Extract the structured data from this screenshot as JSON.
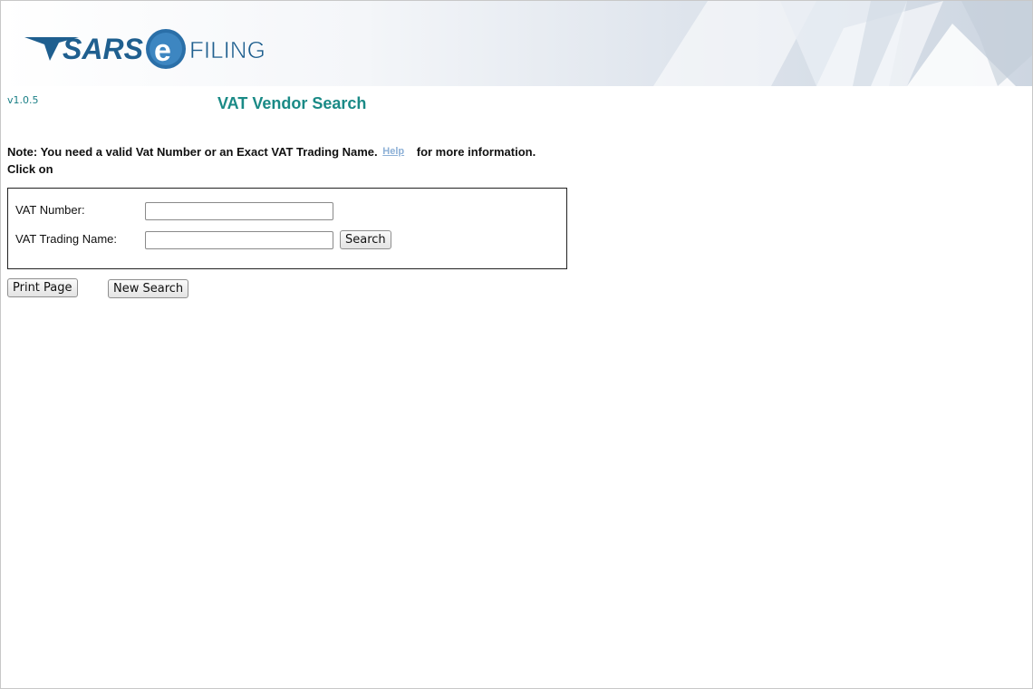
{
  "header": {
    "logo": {
      "sars_text": "SARS",
      "efiling_letter": "e",
      "efiling_text": "FILING"
    }
  },
  "version": "v1.0.5",
  "page_title": "VAT Vendor Search",
  "note": {
    "text": "Note: You need a valid Vat Number or an Exact VAT Trading Name.",
    "help_link": "Help",
    "suffix": "for more information.",
    "click_on": "Click on"
  },
  "form": {
    "vat_number_label": "VAT Number:",
    "vat_number_value": "",
    "trading_name_label": "VAT Trading Name:",
    "trading_name_value": "",
    "search_button": "Search"
  },
  "actions": {
    "print_button": "Print Page",
    "new_search_button": "New Search"
  },
  "colors": {
    "title": "#1a8a86",
    "logo_blue": "#1f5f8f",
    "help_link": "#8db0d6"
  }
}
